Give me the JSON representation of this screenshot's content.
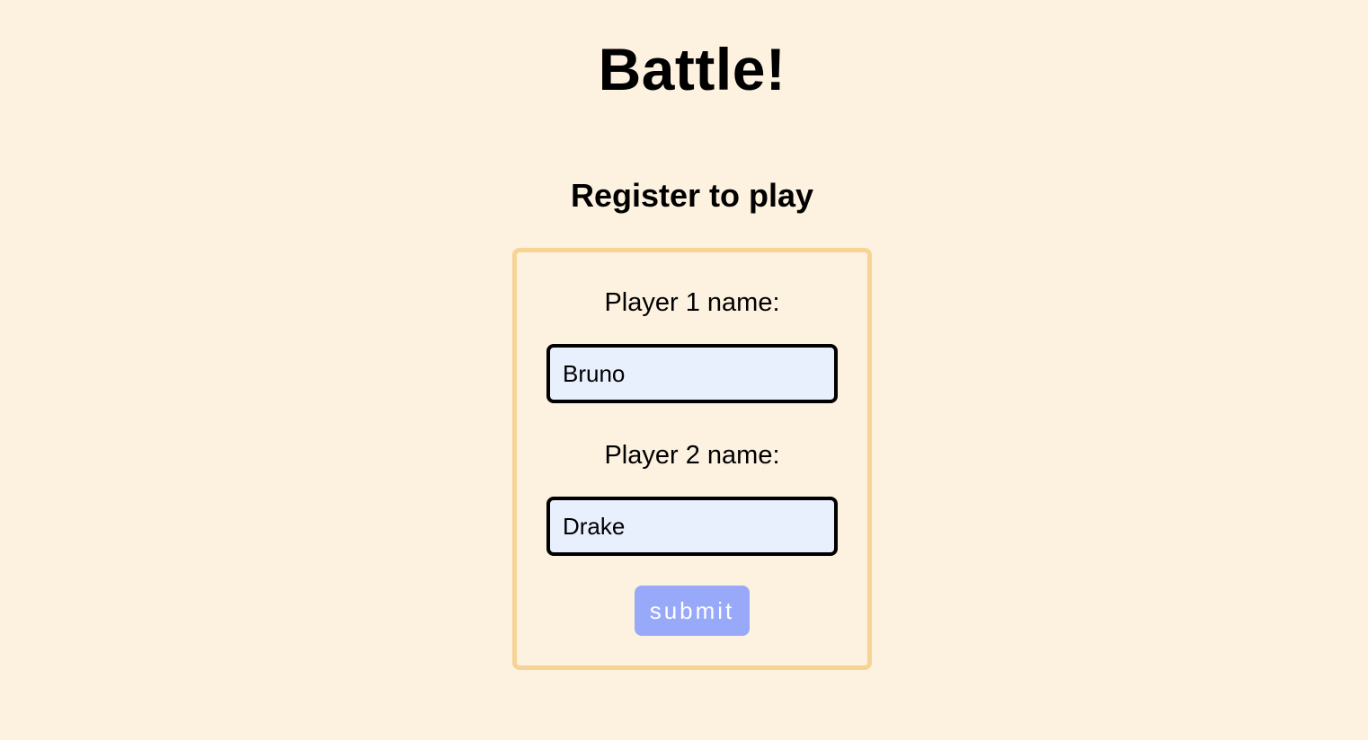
{
  "page": {
    "title": "Battle!",
    "background_color": "#fdf1df"
  },
  "form": {
    "heading": "Register to play",
    "border_color": "#f7d396",
    "player1": {
      "label": "Player 1 name:",
      "value": "Bruno"
    },
    "player2": {
      "label": "Player 2 name:",
      "value": "Drake"
    },
    "submit_label": "submit",
    "submit_color": "#99a9f9",
    "input_background": "#e8f0fd"
  }
}
